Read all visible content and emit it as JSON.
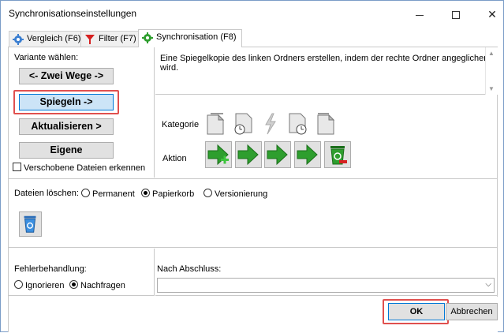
{
  "window": {
    "title": "Synchronisationseinstellungen",
    "minimize_label": "—",
    "close_label": "✕"
  },
  "tabs": [
    {
      "label": "Vergleich (F6)",
      "icon": "gear-icon",
      "active": false
    },
    {
      "label": "Filter (F7)",
      "icon": "filter-icon",
      "active": false
    },
    {
      "label": "Synchronisation (F8)",
      "icon": "gear-icon",
      "active": true
    }
  ],
  "variant": {
    "label": "Variante wählen:",
    "buttons": [
      {
        "label": "<- Zwei Wege ->",
        "selected": false
      },
      {
        "label": "Spiegeln ->",
        "selected": true
      },
      {
        "label": "Aktualisieren >",
        "selected": false
      },
      {
        "label": "Eigene",
        "selected": false
      }
    ],
    "detect_moved_label": "Verschobene Dateien erkennen",
    "detect_moved_checked": false
  },
  "description": "Eine Spiegelkopie des linken Ordners erstellen, indem der rechte Ordner angeglichen wird.",
  "category": {
    "label": "Kategorie",
    "icons": [
      "file-left-only-icon",
      "file-left-newer-icon",
      "file-different-icon",
      "file-right-newer-icon",
      "file-right-only-icon"
    ]
  },
  "action": {
    "label": "Aktion",
    "icons": [
      "create-right-icon",
      "update-right-icon",
      "update-right-icon",
      "update-right-icon",
      "delete-right-icon"
    ]
  },
  "delete_files": {
    "label": "Dateien löschen:",
    "options": [
      "Permanent",
      "Papierkorb",
      "Versionierung"
    ],
    "selected": "Papierkorb"
  },
  "error_handling": {
    "label": "Fehlerbehandlung:",
    "options": [
      "Ignorieren",
      "Nachfragen"
    ],
    "selected": "Nachfragen"
  },
  "after_completion": {
    "label": "Nach Abschluss:",
    "value": ""
  },
  "footer": {
    "ok_label": "OK",
    "cancel_label": "Abbrechen"
  },
  "colors": {
    "highlight": "#e0504f",
    "accent": "#0078d7",
    "green": "#2e9e2e"
  }
}
